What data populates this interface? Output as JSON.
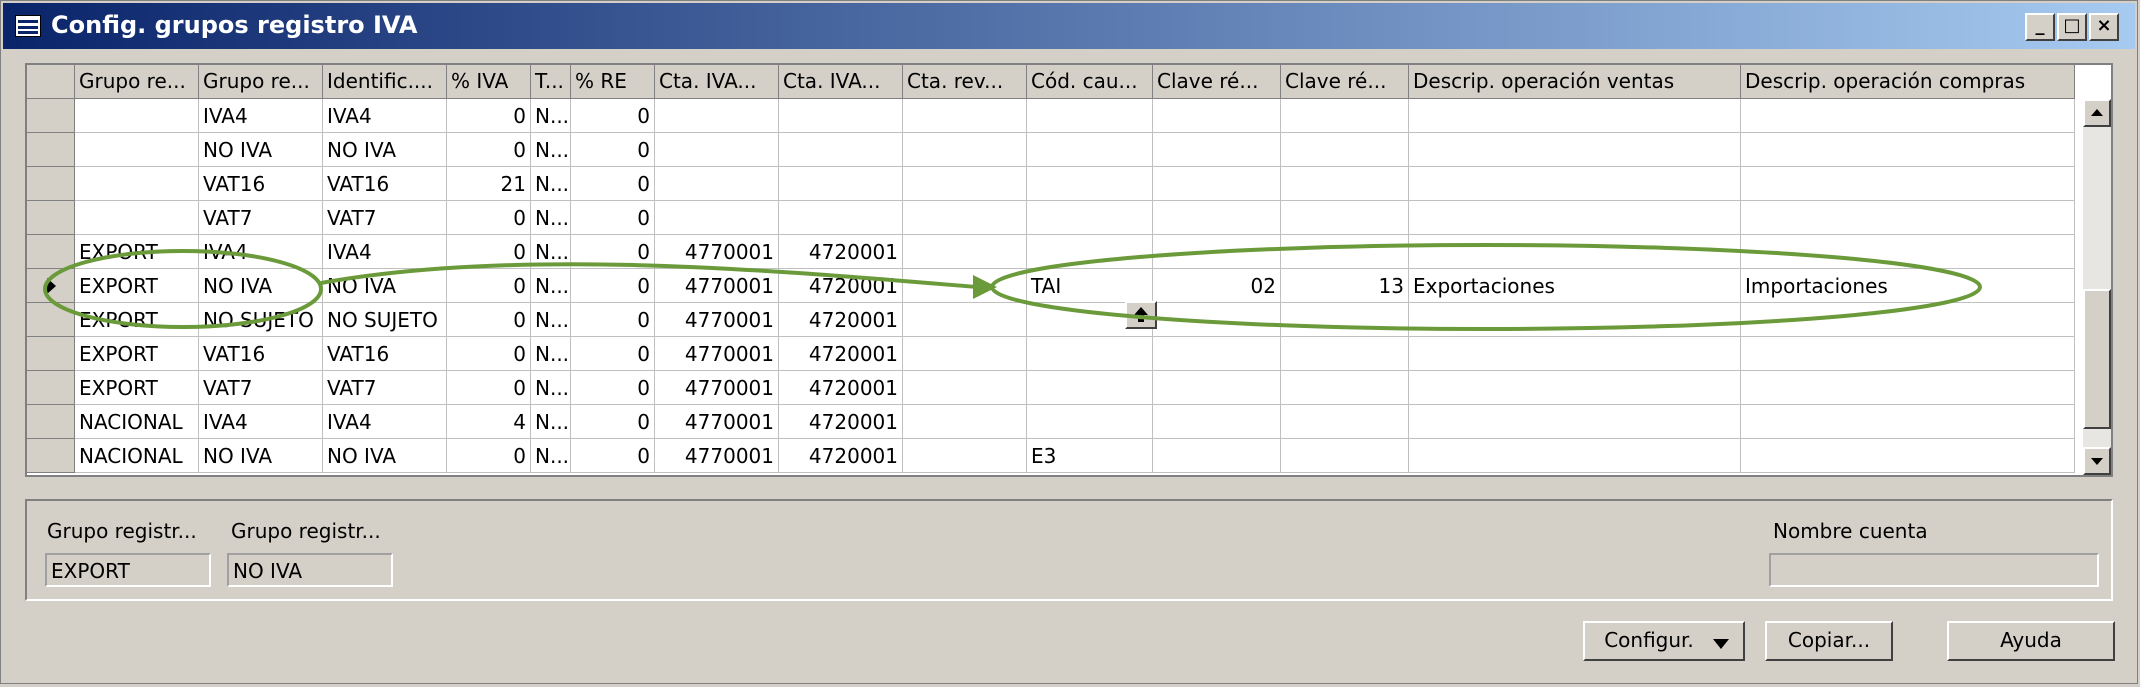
{
  "window": {
    "title": "Config. grupos registro IVA",
    "controls": [
      "_",
      "□",
      "×"
    ]
  },
  "grid": {
    "columns": [
      {
        "label": "",
        "w": 48
      },
      {
        "label": "Grupo re...",
        "w": 124
      },
      {
        "label": "Grupo re...",
        "w": 124
      },
      {
        "label": "Identific....",
        "w": 124
      },
      {
        "label": "% IVA",
        "w": 84
      },
      {
        "label": "T...",
        "w": 40
      },
      {
        "label": "% RE",
        "w": 84
      },
      {
        "label": "Cta. IVA...",
        "w": 124
      },
      {
        "label": "Cta. IVA...",
        "w": 124
      },
      {
        "label": "Cta. rev...",
        "w": 124
      },
      {
        "label": "Cód. cau...",
        "w": 126
      },
      {
        "label": "Clave ré...",
        "w": 128
      },
      {
        "label": "Clave ré...",
        "w": 128
      },
      {
        "label": "Descrip. operación ventas",
        "w": 332
      },
      {
        "label": "Descrip. operación compras",
        "w": 334
      }
    ],
    "rows": [
      [
        "",
        "IVA4",
        "IVA4",
        "0",
        "N...",
        "0",
        "",
        "",
        "",
        "",
        "",
        "",
        "",
        ""
      ],
      [
        "",
        "NO IVA",
        "NO IVA",
        "0",
        "N...",
        "0",
        "",
        "",
        "",
        "",
        "",
        "",
        "",
        ""
      ],
      [
        "",
        "VAT16",
        "VAT16",
        "21",
        "N...",
        "0",
        "",
        "",
        "",
        "",
        "",
        "",
        "",
        ""
      ],
      [
        "",
        "VAT7",
        "VAT7",
        "0",
        "N...",
        "0",
        "",
        "",
        "",
        "",
        "",
        "",
        "",
        ""
      ],
      [
        "EXPORT",
        "IVA4",
        "IVA4",
        "0",
        "N...",
        "0",
        "4770001",
        "4720001",
        "",
        "",
        "",
        "",
        "",
        ""
      ],
      [
        "EXPORT",
        "NO IVA",
        "NO IVA",
        "0",
        "N...",
        "0",
        "4770001",
        "4720001",
        "",
        "TAI",
        "02",
        "13",
        "Exportaciones",
        "Importaciones"
      ],
      [
        "EXPORT",
        "NO SUJETO",
        "NO SUJETO",
        "0",
        "N...",
        "0",
        "4770001",
        "4720001",
        "",
        "",
        "",
        "",
        "",
        ""
      ],
      [
        "EXPORT",
        "VAT16",
        "VAT16",
        "0",
        "N...",
        "0",
        "4770001",
        "4720001",
        "",
        "",
        "",
        "",
        "",
        ""
      ],
      [
        "EXPORT",
        "VAT7",
        "VAT7",
        "0",
        "N...",
        "0",
        "4770001",
        "4720001",
        "",
        "",
        "",
        "",
        "",
        ""
      ],
      [
        "NACIONAL",
        "IVA4",
        "IVA4",
        "4",
        "N...",
        "0",
        "4770001",
        "4720001",
        "",
        "",
        "",
        "",
        "",
        ""
      ],
      [
        "NACIONAL",
        "NO IVA",
        "NO IVA",
        "0",
        "N...",
        "0",
        "4770001",
        "4720001",
        "",
        "E3",
        "",
        "",
        "",
        ""
      ]
    ],
    "numeric_columns": [
      3,
      5,
      6,
      7,
      10,
      11
    ],
    "selected_row": 5
  },
  "panel": {
    "label1": "Grupo registr...",
    "value1": "EXPORT",
    "label2": "Grupo registr...",
    "value2": "NO IVA",
    "label3": "Nombre cuenta",
    "value3": ""
  },
  "buttons": {
    "configur": "Configur.",
    "copiar": "Copiar...",
    "ayuda": "Ayuda"
  },
  "annotation_color": "#6a9a3a"
}
